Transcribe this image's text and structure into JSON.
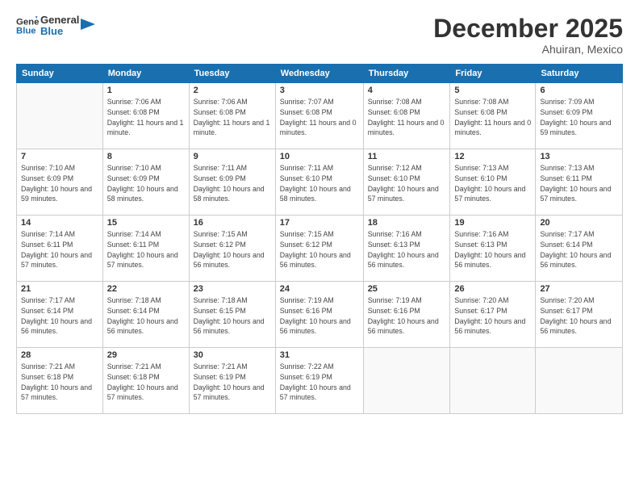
{
  "header": {
    "logo_line1": "General",
    "logo_line2": "Blue",
    "month": "December 2025",
    "location": "Ahuiran, Mexico"
  },
  "weekdays": [
    "Sunday",
    "Monday",
    "Tuesday",
    "Wednesday",
    "Thursday",
    "Friday",
    "Saturday"
  ],
  "weeks": [
    [
      {
        "day": "",
        "sunrise": "",
        "sunset": "",
        "daylight": ""
      },
      {
        "day": "1",
        "sunrise": "Sunrise: 7:06 AM",
        "sunset": "Sunset: 6:08 PM",
        "daylight": "Daylight: 11 hours and 1 minute."
      },
      {
        "day": "2",
        "sunrise": "Sunrise: 7:06 AM",
        "sunset": "Sunset: 6:08 PM",
        "daylight": "Daylight: 11 hours and 1 minute."
      },
      {
        "day": "3",
        "sunrise": "Sunrise: 7:07 AM",
        "sunset": "Sunset: 6:08 PM",
        "daylight": "Daylight: 11 hours and 0 minutes."
      },
      {
        "day": "4",
        "sunrise": "Sunrise: 7:08 AM",
        "sunset": "Sunset: 6:08 PM",
        "daylight": "Daylight: 11 hours and 0 minutes."
      },
      {
        "day": "5",
        "sunrise": "Sunrise: 7:08 AM",
        "sunset": "Sunset: 6:08 PM",
        "daylight": "Daylight: 11 hours and 0 minutes."
      },
      {
        "day": "6",
        "sunrise": "Sunrise: 7:09 AM",
        "sunset": "Sunset: 6:09 PM",
        "daylight": "Daylight: 10 hours and 59 minutes."
      }
    ],
    [
      {
        "day": "7",
        "sunrise": "Sunrise: 7:10 AM",
        "sunset": "Sunset: 6:09 PM",
        "daylight": "Daylight: 10 hours and 59 minutes."
      },
      {
        "day": "8",
        "sunrise": "Sunrise: 7:10 AM",
        "sunset": "Sunset: 6:09 PM",
        "daylight": "Daylight: 10 hours and 58 minutes."
      },
      {
        "day": "9",
        "sunrise": "Sunrise: 7:11 AM",
        "sunset": "Sunset: 6:09 PM",
        "daylight": "Daylight: 10 hours and 58 minutes."
      },
      {
        "day": "10",
        "sunrise": "Sunrise: 7:11 AM",
        "sunset": "Sunset: 6:10 PM",
        "daylight": "Daylight: 10 hours and 58 minutes."
      },
      {
        "day": "11",
        "sunrise": "Sunrise: 7:12 AM",
        "sunset": "Sunset: 6:10 PM",
        "daylight": "Daylight: 10 hours and 57 minutes."
      },
      {
        "day": "12",
        "sunrise": "Sunrise: 7:13 AM",
        "sunset": "Sunset: 6:10 PM",
        "daylight": "Daylight: 10 hours and 57 minutes."
      },
      {
        "day": "13",
        "sunrise": "Sunrise: 7:13 AM",
        "sunset": "Sunset: 6:11 PM",
        "daylight": "Daylight: 10 hours and 57 minutes."
      }
    ],
    [
      {
        "day": "14",
        "sunrise": "Sunrise: 7:14 AM",
        "sunset": "Sunset: 6:11 PM",
        "daylight": "Daylight: 10 hours and 57 minutes."
      },
      {
        "day": "15",
        "sunrise": "Sunrise: 7:14 AM",
        "sunset": "Sunset: 6:11 PM",
        "daylight": "Daylight: 10 hours and 57 minutes."
      },
      {
        "day": "16",
        "sunrise": "Sunrise: 7:15 AM",
        "sunset": "Sunset: 6:12 PM",
        "daylight": "Daylight: 10 hours and 56 minutes."
      },
      {
        "day": "17",
        "sunrise": "Sunrise: 7:15 AM",
        "sunset": "Sunset: 6:12 PM",
        "daylight": "Daylight: 10 hours and 56 minutes."
      },
      {
        "day": "18",
        "sunrise": "Sunrise: 7:16 AM",
        "sunset": "Sunset: 6:13 PM",
        "daylight": "Daylight: 10 hours and 56 minutes."
      },
      {
        "day": "19",
        "sunrise": "Sunrise: 7:16 AM",
        "sunset": "Sunset: 6:13 PM",
        "daylight": "Daylight: 10 hours and 56 minutes."
      },
      {
        "day": "20",
        "sunrise": "Sunrise: 7:17 AM",
        "sunset": "Sunset: 6:14 PM",
        "daylight": "Daylight: 10 hours and 56 minutes."
      }
    ],
    [
      {
        "day": "21",
        "sunrise": "Sunrise: 7:17 AM",
        "sunset": "Sunset: 6:14 PM",
        "daylight": "Daylight: 10 hours and 56 minutes."
      },
      {
        "day": "22",
        "sunrise": "Sunrise: 7:18 AM",
        "sunset": "Sunset: 6:14 PM",
        "daylight": "Daylight: 10 hours and 56 minutes."
      },
      {
        "day": "23",
        "sunrise": "Sunrise: 7:18 AM",
        "sunset": "Sunset: 6:15 PM",
        "daylight": "Daylight: 10 hours and 56 minutes."
      },
      {
        "day": "24",
        "sunrise": "Sunrise: 7:19 AM",
        "sunset": "Sunset: 6:16 PM",
        "daylight": "Daylight: 10 hours and 56 minutes."
      },
      {
        "day": "25",
        "sunrise": "Sunrise: 7:19 AM",
        "sunset": "Sunset: 6:16 PM",
        "daylight": "Daylight: 10 hours and 56 minutes."
      },
      {
        "day": "26",
        "sunrise": "Sunrise: 7:20 AM",
        "sunset": "Sunset: 6:17 PM",
        "daylight": "Daylight: 10 hours and 56 minutes."
      },
      {
        "day": "27",
        "sunrise": "Sunrise: 7:20 AM",
        "sunset": "Sunset: 6:17 PM",
        "daylight": "Daylight: 10 hours and 56 minutes."
      }
    ],
    [
      {
        "day": "28",
        "sunrise": "Sunrise: 7:21 AM",
        "sunset": "Sunset: 6:18 PM",
        "daylight": "Daylight: 10 hours and 57 minutes."
      },
      {
        "day": "29",
        "sunrise": "Sunrise: 7:21 AM",
        "sunset": "Sunset: 6:18 PM",
        "daylight": "Daylight: 10 hours and 57 minutes."
      },
      {
        "day": "30",
        "sunrise": "Sunrise: 7:21 AM",
        "sunset": "Sunset: 6:19 PM",
        "daylight": "Daylight: 10 hours and 57 minutes."
      },
      {
        "day": "31",
        "sunrise": "Sunrise: 7:22 AM",
        "sunset": "Sunset: 6:19 PM",
        "daylight": "Daylight: 10 hours and 57 minutes."
      },
      {
        "day": "",
        "sunrise": "",
        "sunset": "",
        "daylight": ""
      },
      {
        "day": "",
        "sunrise": "",
        "sunset": "",
        "daylight": ""
      },
      {
        "day": "",
        "sunrise": "",
        "sunset": "",
        "daylight": ""
      }
    ]
  ]
}
